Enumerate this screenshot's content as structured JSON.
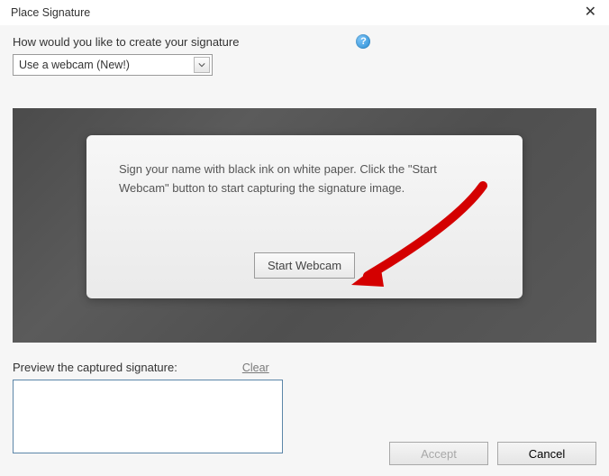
{
  "titlebar": {
    "title": "Place Signature"
  },
  "question": "How would you like to create your signature",
  "dropdown": {
    "selected": "Use a webcam (New!)"
  },
  "panel": {
    "instruction": "Sign your name with black ink on white paper. Click the \"Start Webcam\" button to start capturing the signature image.",
    "start_label": "Start Webcam"
  },
  "preview": {
    "label": "Preview the captured signature:",
    "clear": "Clear"
  },
  "footer": {
    "accept": "Accept",
    "cancel": "Cancel"
  }
}
